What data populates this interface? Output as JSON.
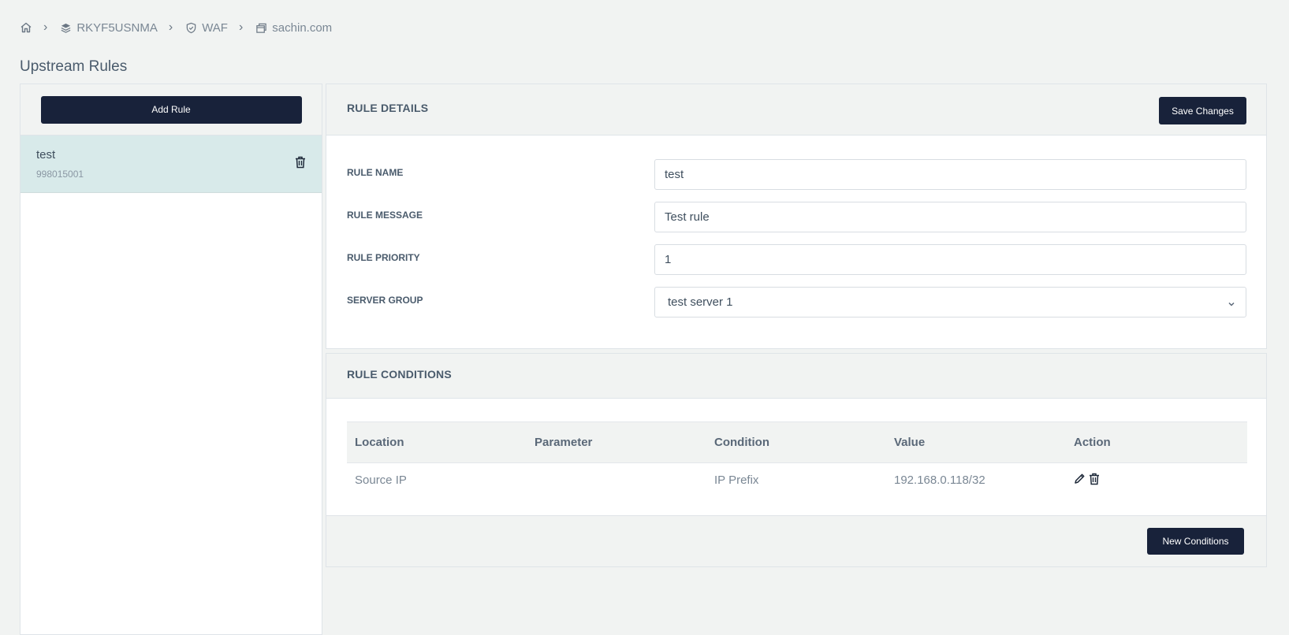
{
  "breadcrumb": {
    "items": [
      {
        "icon": "home-icon",
        "label": ""
      },
      {
        "icon": "layers-icon",
        "label": "RKYF5USNMA"
      },
      {
        "icon": "shield-check-icon",
        "label": "WAF"
      },
      {
        "icon": "window-icon",
        "label": "sachin.com"
      }
    ],
    "separator": "›"
  },
  "page": {
    "title": "Upstream Rules"
  },
  "sidebar": {
    "add_label": "Add Rule",
    "rules": [
      {
        "name": "test",
        "id": "998015001",
        "delete_icon": "trash-icon"
      }
    ]
  },
  "details": {
    "title": "RULE DETAILS",
    "save_label": "Save Changes",
    "fields": {
      "name": {
        "label": "RULE NAME",
        "value": "test"
      },
      "message": {
        "label": "RULE MESSAGE",
        "value": "Test rule"
      },
      "priority": {
        "label": "RULE PRIORITY",
        "value": "1"
      },
      "server_group": {
        "label": "SERVER GROUP",
        "value": "test server 1"
      }
    }
  },
  "conditions": {
    "title": "RULE CONDITIONS",
    "columns": [
      "Location",
      "Parameter",
      "Condition",
      "Value",
      "Action"
    ],
    "rows": [
      {
        "location": "Source IP",
        "parameter": "",
        "condition": "IP Prefix",
        "value": "192.168.0.118/32"
      }
    ],
    "new_label": "New Conditions"
  },
  "colors": {
    "button_dark": "#18223a",
    "selected_row": "#d8eaea",
    "background": "#f1f3f2"
  }
}
